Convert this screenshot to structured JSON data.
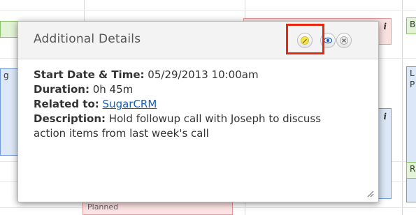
{
  "popup": {
    "title": "Additional Details",
    "fields": {
      "start_label": "Start Date & Time:",
      "start_value": "05/29/2013 10:00am",
      "duration_label": "Duration:",
      "duration_value": "0h 45m",
      "related_label": "Related to:",
      "related_value": "SugarCRM",
      "description_label": "Description:",
      "description_value": "Hold followup call with Joseph to discuss action items from last week's call"
    },
    "buttons": {
      "edit": "edit-icon",
      "view": "eye-icon",
      "close": "close-icon"
    }
  },
  "calendar": {
    "event_left_letter": "g",
    "event_top_italic": "i",
    "event_mid_italic": "i",
    "event_right_b": "B",
    "event_right_l": "L",
    "event_right_p": "P",
    "event_right_r": "R",
    "event_bottom": "Planned"
  },
  "colors": {
    "highlight": "#e8270f",
    "link": "#1a5fb4"
  }
}
